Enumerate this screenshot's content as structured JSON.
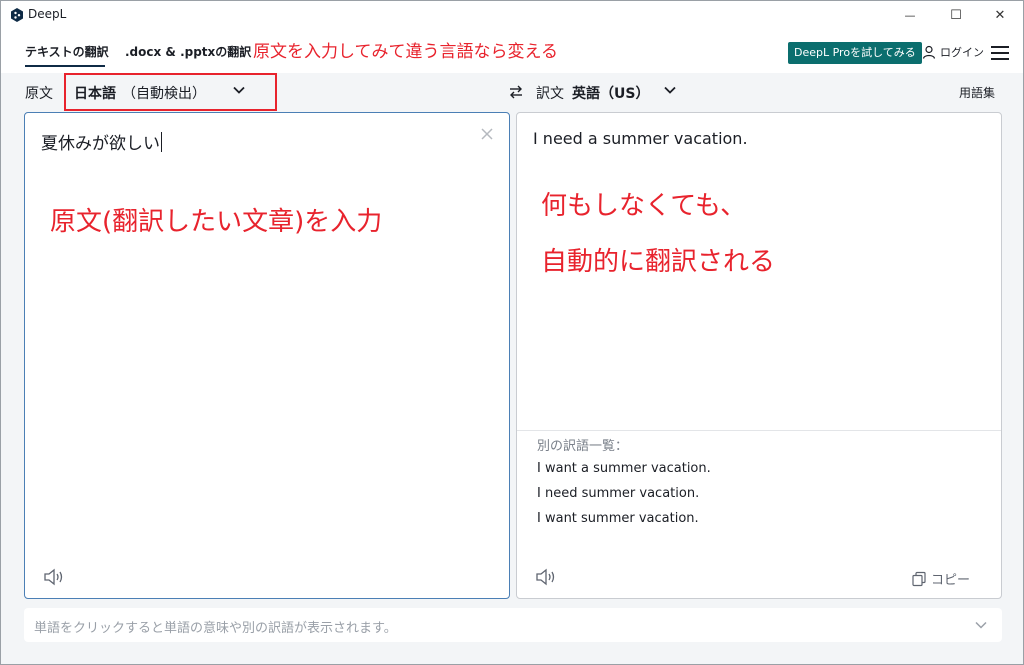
{
  "window": {
    "title": "DeepL",
    "minimize_glyph": "—",
    "maximize_glyph": "☐",
    "close_glyph": "✕"
  },
  "toolbar": {
    "tab_text": "テキストの翻訳",
    "tab_docs": ".docx & .pptxの翻訳",
    "annotation": "原文を入力してみて違う言語なら変える",
    "pro_button": "DeepL Proを試してみる",
    "login": "ログイン"
  },
  "language_bar": {
    "source_label": "原文",
    "source_language": "日本語",
    "source_detect": "（自動検出）",
    "target_label": "訳文",
    "target_language": "英語（US）",
    "glossary": "用語集"
  },
  "source_panel": {
    "text": "夏休みが欲しい",
    "annotation": "原文(翻訳したい文章)を入力"
  },
  "target_panel": {
    "text": "I need a summer vacation.",
    "annotation_line1": "何もしなくても、",
    "annotation_line2": "自動的に翻訳される",
    "alternatives_heading": "別の訳語一覧：",
    "alternatives": [
      "I want a summer vacation.",
      "I need summer vacation.",
      "I want summer vacation."
    ],
    "copy_label": "コピー"
  },
  "hint_bar": {
    "text": "単語をクリックすると単語の意味や別の訳語が表示されます。"
  },
  "colors": {
    "annotation_red": "#e8232d",
    "pro_button_bg": "#0b6e6e",
    "active_tab_underline": "#0f2b46"
  }
}
